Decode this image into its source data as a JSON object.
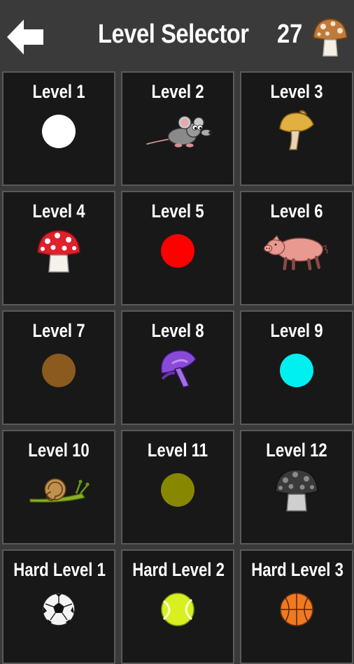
{
  "header": {
    "title": "Level Selector",
    "mushroom_count": "27",
    "back_icon": "back-arrow-icon",
    "count_icon": "mushroom-icon"
  },
  "levels": [
    {
      "label": "Level 1",
      "icon": "white-dot",
      "color": "#ffffff"
    },
    {
      "label": "Level 2",
      "icon": "mouse"
    },
    {
      "label": "Level 3",
      "icon": "yellow-mushroom"
    },
    {
      "label": "Level 4",
      "icon": "red-spotted-mushroom"
    },
    {
      "label": "Level 5",
      "icon": "red-dot",
      "color": "#ff0000"
    },
    {
      "label": "Level 6",
      "icon": "pig"
    },
    {
      "label": "Level 7",
      "icon": "brown-dot",
      "color": "#8b5a1e"
    },
    {
      "label": "Level 8",
      "icon": "purple-mushroom"
    },
    {
      "label": "Level 9",
      "icon": "cyan-dot",
      "color": "#00f0f0"
    },
    {
      "label": "Level 10",
      "icon": "snail"
    },
    {
      "label": "Level 11",
      "icon": "olive-dot",
      "color": "#888800"
    },
    {
      "label": "Level 12",
      "icon": "gray-spotted-mushroom"
    },
    {
      "label": "Hard Level 1",
      "icon": "soccer-ball"
    },
    {
      "label": "Hard Level 2",
      "icon": "tennis-ball"
    },
    {
      "label": "Hard Level 3",
      "icon": "basketball"
    }
  ]
}
